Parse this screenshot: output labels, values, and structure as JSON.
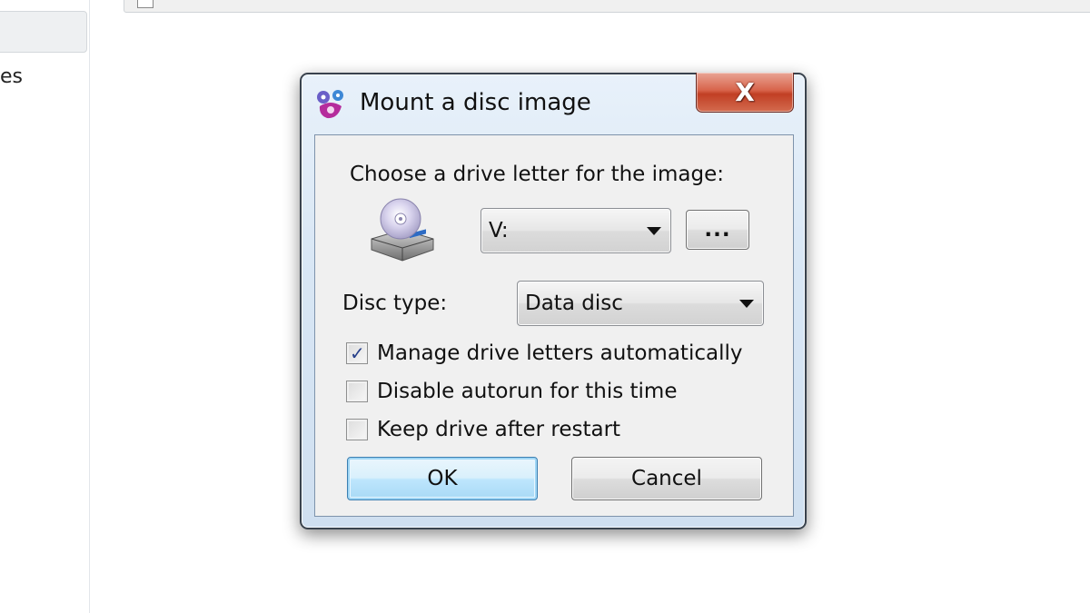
{
  "background": {
    "sidebar_text": "es"
  },
  "dialog": {
    "title": "Mount a disc image",
    "close_label": "X",
    "drive_letter_label": "Choose a drive letter for the image:",
    "drive_letter_value": "V:",
    "browse_label": "...",
    "disc_type_label": "Disc type:",
    "disc_type_value": "Data disc",
    "checkboxes": [
      {
        "label": "Manage drive letters automatically",
        "checked": true
      },
      {
        "label": "Disable autorun for this time",
        "checked": false
      },
      {
        "label": "Keep drive after restart",
        "checked": false
      }
    ],
    "ok_label": "OK",
    "cancel_label": "Cancel",
    "icons": {
      "title": "daemon-tools-icon",
      "drive": "disc-drive-icon"
    }
  }
}
